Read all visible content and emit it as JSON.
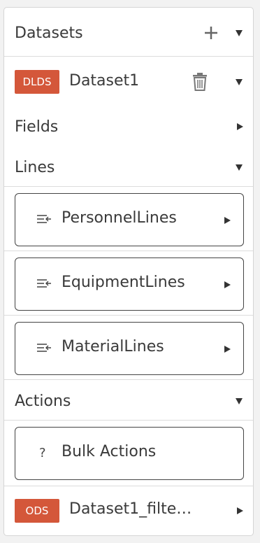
{
  "header": {
    "title": "Datasets"
  },
  "dataset1": {
    "badge": "DLDS",
    "name": "Dataset1"
  },
  "sections": {
    "fields": "Fields",
    "lines": "Lines",
    "actions": "Actions"
  },
  "lines": [
    {
      "label": "PersonnelLines",
      "icon": "lines-icon"
    },
    {
      "label": "EquipmentLines",
      "icon": "lines-icon"
    },
    {
      "label": "MaterialLines",
      "icon": "lines-icon"
    }
  ],
  "actions": [
    {
      "label": "Bulk Actions",
      "icon": "?"
    }
  ],
  "dataset2": {
    "badge": "ODS",
    "name": "Dataset1_filte…"
  },
  "colors": {
    "badge": "#d4573a",
    "border": "#d5d5d5"
  }
}
